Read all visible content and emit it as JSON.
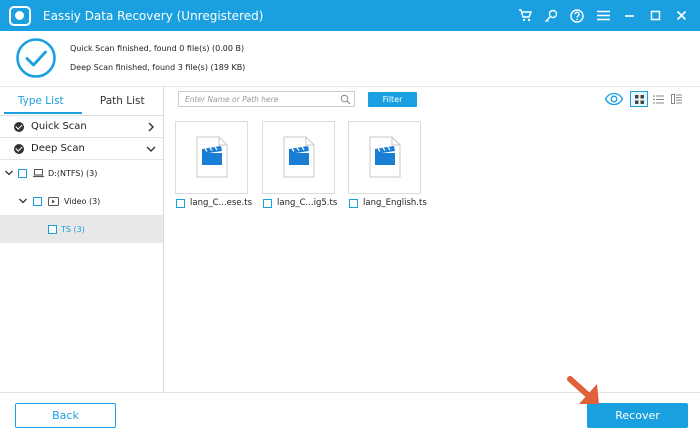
{
  "window": {
    "title": "Eassiy Data Recovery (Unregistered)",
    "icons": [
      "cart-icon",
      "key-icon",
      "help-icon",
      "menu-icon",
      "minimize-icon",
      "maximize-icon",
      "close-icon"
    ]
  },
  "status": {
    "quick_scan": "Quick Scan finished, found 0 file(s) (0.00  B)",
    "deep_scan": "Deep Scan finished, found 3 file(s) (189 KB)"
  },
  "tabs": [
    {
      "label": "Type List",
      "active": true
    },
    {
      "label": "Path List",
      "active": false
    }
  ],
  "scans": [
    {
      "label": "Quick Scan",
      "expanded": false
    },
    {
      "label": "Deep Scan",
      "expanded": true
    }
  ],
  "tree": [
    {
      "label": "D:(NTFS) (3)",
      "icon": "drive-icon",
      "checked": false
    },
    {
      "label": "Video (3)",
      "icon": "video-icon",
      "checked": false
    },
    {
      "label": "TS (3)",
      "checked": false,
      "selected": true
    }
  ],
  "search": {
    "placeholder": "Enter Name or Path here",
    "value": ""
  },
  "filter_label": "Filter",
  "view_modes": {
    "active": "grid",
    "options": [
      "grid",
      "list",
      "detail"
    ]
  },
  "files": [
    {
      "name": "lang_C...ese.ts",
      "checked": false
    },
    {
      "name": "lang_C...ig5.ts",
      "checked": false
    },
    {
      "name": "lang_English.ts",
      "checked": false
    }
  ],
  "buttons": {
    "back": "Back",
    "recover": "Recover"
  },
  "colors": {
    "accent": "#1aa0e0",
    "arrow": "#e0603a",
    "file_icon": "#1a7fd4"
  }
}
